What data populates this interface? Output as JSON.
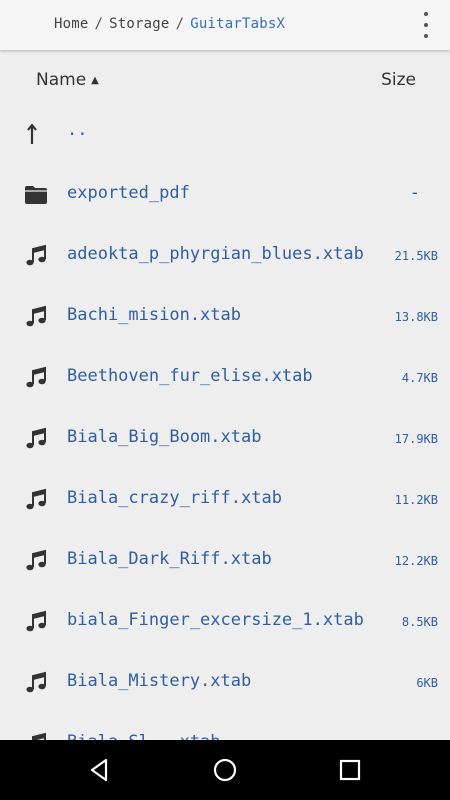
{
  "breadcrumb": {
    "items": [
      "Home",
      "Storage",
      "GuitarTabsX"
    ],
    "separator": "/"
  },
  "toolbar": {
    "menu_icon": "more-vert-icon"
  },
  "columns": {
    "name": "Name",
    "name_sort": "ascending",
    "size": "Size"
  },
  "parent_dir": {
    "label": "..",
    "icon": "up-arrow-icon"
  },
  "files": [
    {
      "name": "exported_pdf",
      "size": "-",
      "icon": "folder-icon"
    },
    {
      "name": "adeokta_p_phyrgian_blues.xtab",
      "size": "21.5KB",
      "icon": "music-note-icon"
    },
    {
      "name": "Bachi_mision.xtab",
      "size": "13.8KB",
      "icon": "music-note-icon"
    },
    {
      "name": "Beethoven_fur_elise.xtab",
      "size": "4.7KB",
      "icon": "music-note-icon"
    },
    {
      "name": "Biala_Big_Boom.xtab",
      "size": "17.9KB",
      "icon": "music-note-icon"
    },
    {
      "name": "Biala_crazy_riff.xtab",
      "size": "11.2KB",
      "icon": "music-note-icon"
    },
    {
      "name": "Biala_Dark_Riff.xtab",
      "size": "12.2KB",
      "icon": "music-note-icon"
    },
    {
      "name": "biala_Finger_excersize_1.xtab",
      "size": "8.5KB",
      "icon": "music-note-icon"
    },
    {
      "name": "Biala_Mistery.xtab",
      "size": "6KB",
      "icon": "music-note-icon"
    },
    {
      "name": "Biala_Sl...xtab",
      "size": "",
      "icon": "music-note-icon"
    }
  ],
  "navbar": {
    "back": "back-triangle-icon",
    "home": "home-circle-icon",
    "recents": "recents-square-icon"
  },
  "colors": {
    "link": "#2f5f9f",
    "background": "#eeeeee",
    "navbar": "#000000"
  }
}
